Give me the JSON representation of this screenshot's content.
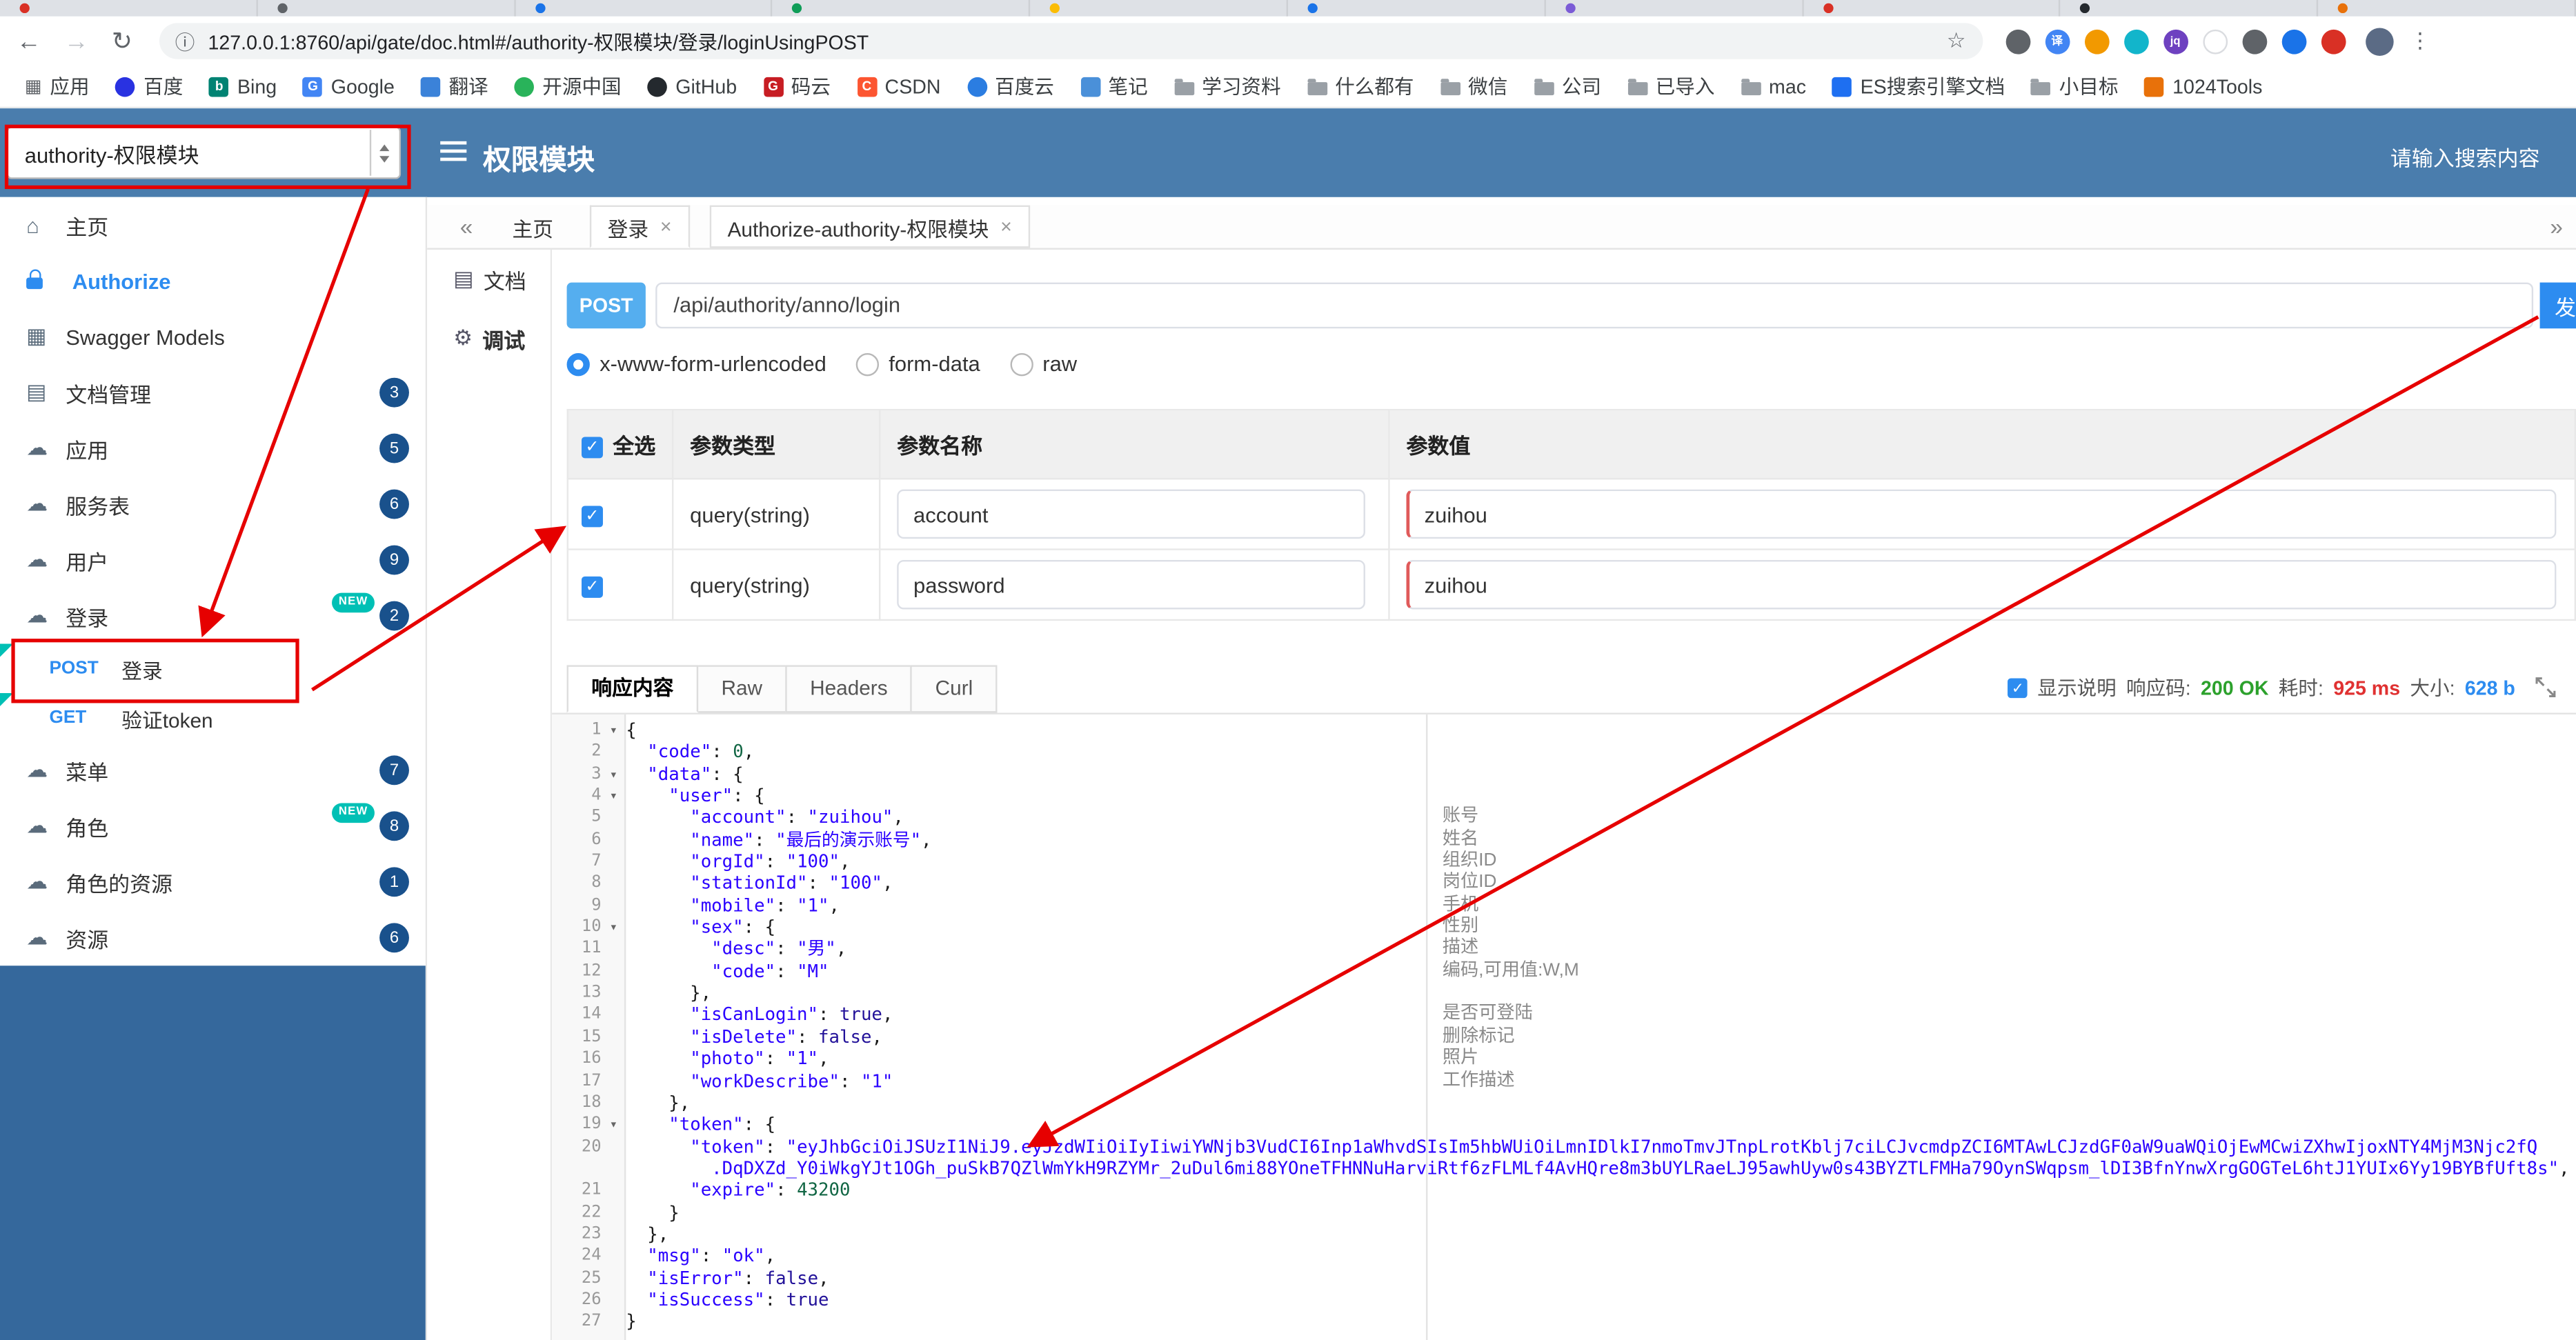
{
  "browser": {
    "tab_favicon_colors": [
      "#d93025",
      "#5f6368",
      "#1a73e8",
      "#0f9d58",
      "#fbbc04",
      "#1a73e8",
      "#7b5bd6",
      "#d93025",
      "#24292e",
      "#e8710a"
    ],
    "url": "127.0.0.1:8760/api/gate/doc.html#/authority-权限模块/登录/loginUsingPOST",
    "extensions": [
      {
        "color": "#5f6368"
      },
      {
        "color": "#4285f4",
        "letter": "译"
      },
      {
        "color": "#f29900"
      },
      {
        "color": "#12b5cb"
      },
      {
        "color": "#6e41c0",
        "letter": "jq"
      },
      {
        "color": "#ffffff"
      },
      {
        "color": "#5f6368"
      },
      {
        "color": "#1a73e8"
      },
      {
        "color": "#d93025"
      }
    ],
    "bookmarks": [
      {
        "label": "应用",
        "icon": "apps"
      },
      {
        "label": "百度",
        "icon": "dot",
        "color": "#2932e1"
      },
      {
        "label": "Bing",
        "icon": "letter",
        "letter": "b",
        "color": "#008373"
      },
      {
        "label": "Google",
        "icon": "letter",
        "letter": "G",
        "color": "#4285f4"
      },
      {
        "label": "翻译",
        "icon": "square",
        "color": "#3b82d9"
      },
      {
        "label": "开源中国",
        "icon": "dot",
        "color": "#29b35a"
      },
      {
        "label": "GitHub",
        "icon": "dot",
        "color": "#24292e"
      },
      {
        "label": "码云",
        "icon": "letter",
        "letter": "G",
        "color": "#c71d23"
      },
      {
        "label": "CSDN",
        "icon": "letter",
        "letter": "C",
        "color": "#fc5531"
      },
      {
        "label": "百度云",
        "icon": "dot",
        "color": "#2b7de1"
      },
      {
        "label": "笔记",
        "icon": "square",
        "color": "#4a90d9"
      },
      {
        "label": "学习资料",
        "icon": "folder"
      },
      {
        "label": "什么都有",
        "icon": "folder"
      },
      {
        "label": "微信",
        "icon": "folder"
      },
      {
        "label": "公司",
        "icon": "folder"
      },
      {
        "label": "已导入",
        "icon": "folder"
      },
      {
        "label": "mac",
        "icon": "folder"
      },
      {
        "label": "ES搜索引擎文档",
        "icon": "square",
        "color": "#1e6ff1"
      },
      {
        "label": "小目标",
        "icon": "folder"
      },
      {
        "label": "1024Tools",
        "icon": "square",
        "color": "#e8710a"
      }
    ]
  },
  "header": {
    "module_select": "authority-权限模块",
    "title": "权限模块",
    "search_placeholder": "请输入搜索内容"
  },
  "sidebar": {
    "items": [
      {
        "key": "home",
        "icon": "home",
        "label": "主页"
      },
      {
        "key": "authorize",
        "icon": "lock",
        "label": "Authorize",
        "accent": true
      },
      {
        "key": "swagger-models",
        "icon": "models",
        "label": "Swagger Models"
      },
      {
        "key": "doc-management",
        "icon": "doc",
        "label": "文档管理",
        "badge": "3"
      },
      {
        "key": "application",
        "icon": "cloud",
        "label": "应用",
        "badge": "5"
      },
      {
        "key": "service-table",
        "icon": "cloud",
        "label": "服务表",
        "badge": "6"
      },
      {
        "key": "user",
        "icon": "cloud",
        "label": "用户",
        "badge": "9"
      },
      {
        "key": "login",
        "icon": "cloud",
        "label": "登录",
        "badge": "2",
        "new": true
      },
      {
        "key": "login-post",
        "type": "api",
        "method": "POST",
        "label": "登录"
      },
      {
        "key": "verify-token-get",
        "type": "api",
        "method": "GET",
        "label": "验证token"
      },
      {
        "key": "menu",
        "icon": "cloud",
        "label": "菜单",
        "badge": "7"
      },
      {
        "key": "role",
        "icon": "cloud",
        "label": "角色",
        "badge": "8",
        "new": true
      },
      {
        "key": "role-resource",
        "icon": "cloud",
        "label": "角色的资源",
        "badge": "1"
      },
      {
        "key": "resource",
        "icon": "cloud",
        "label": "资源",
        "badge": "6"
      }
    ]
  },
  "tabs": {
    "items": [
      {
        "label": "主页",
        "closable": false,
        "active": false
      },
      {
        "label": "登录",
        "closable": true,
        "active": true
      },
      {
        "label": "Authorize-authority-权限模块",
        "closable": true,
        "active": false
      }
    ]
  },
  "doc_tabs": [
    {
      "key": "doc",
      "label": "文档",
      "active": false
    },
    {
      "key": "debug",
      "label": "调试",
      "active": true
    }
  ],
  "request": {
    "method": "POST",
    "url": "/api/authority/anno/login",
    "send_label": "发送",
    "content_types": [
      "x-www-form-urlencoded",
      "form-data",
      "raw"
    ],
    "selected_type": 0
  },
  "params_table": {
    "select_all": "全选",
    "headers": [
      "参数类型",
      "参数名称",
      "参数值"
    ],
    "rows": [
      {
        "type": "query(string)",
        "name": "account",
        "value": "zuihou"
      },
      {
        "type": "query(string)",
        "name": "password",
        "value": "zuihou"
      }
    ]
  },
  "response": {
    "tabs": [
      "响应内容",
      "Raw",
      "Headers",
      "Curl"
    ],
    "active_tab": 0,
    "show_desc_label": "显示说明",
    "meta": [
      {
        "label": "响应码:",
        "value": "200 OK",
        "color": "#2ca12c"
      },
      {
        "label": "耗时:",
        "value": "925 ms",
        "color": "#e03131"
      },
      {
        "label": "大小:",
        "value": "628 b",
        "color": "#2d8cf0"
      }
    ]
  },
  "code": {
    "rows": [
      [
        "1",
        true,
        [
          [
            "p",
            "{"
          ]
        ],
        ""
      ],
      [
        "2",
        false,
        [
          [
            "p",
            "  "
          ],
          [
            "s",
            "\"code\""
          ],
          [
            "p",
            ": "
          ],
          [
            "m",
            "0"
          ],
          [
            "p",
            ","
          ]
        ],
        ""
      ],
      [
        "3",
        true,
        [
          [
            "p",
            "  "
          ],
          [
            "s",
            "\"data\""
          ],
          [
            "p",
            ": {"
          ]
        ],
        ""
      ],
      [
        "4",
        true,
        [
          [
            "p",
            "    "
          ],
          [
            "s",
            "\"user\""
          ],
          [
            "p",
            ": {"
          ]
        ],
        ""
      ],
      [
        "5",
        false,
        [
          [
            "p",
            "      "
          ],
          [
            "s",
            "\"account\""
          ],
          [
            "p",
            ": "
          ],
          [
            "s",
            "\"zuihou\""
          ],
          [
            "p",
            ","
          ]
        ],
        "账号"
      ],
      [
        "6",
        false,
        [
          [
            "p",
            "      "
          ],
          [
            "s",
            "\"name\""
          ],
          [
            "p",
            ": "
          ],
          [
            "s",
            "\"最后的演示账号\""
          ],
          [
            "p",
            ","
          ]
        ],
        "姓名"
      ],
      [
        "7",
        false,
        [
          [
            "p",
            "      "
          ],
          [
            "s",
            "\"orgId\""
          ],
          [
            "p",
            ": "
          ],
          [
            "s",
            "\"100\""
          ],
          [
            "p",
            ","
          ]
        ],
        "组织ID"
      ],
      [
        "8",
        false,
        [
          [
            "p",
            "      "
          ],
          [
            "s",
            "\"stationId\""
          ],
          [
            "p",
            ": "
          ],
          [
            "s",
            "\"100\""
          ],
          [
            "p",
            ","
          ]
        ],
        "岗位ID"
      ],
      [
        "9",
        false,
        [
          [
            "p",
            "      "
          ],
          [
            "s",
            "\"mobile\""
          ],
          [
            "p",
            ": "
          ],
          [
            "s",
            "\"1\""
          ],
          [
            "p",
            ","
          ]
        ],
        "手机"
      ],
      [
        "10",
        true,
        [
          [
            "p",
            "      "
          ],
          [
            "s",
            "\"sex\""
          ],
          [
            "p",
            ": {"
          ]
        ],
        "性别"
      ],
      [
        "11",
        false,
        [
          [
            "p",
            "        "
          ],
          [
            "s",
            "\"desc\""
          ],
          [
            "p",
            ": "
          ],
          [
            "s",
            "\"男\""
          ],
          [
            "p",
            ","
          ]
        ],
        "描述"
      ],
      [
        "12",
        false,
        [
          [
            "p",
            "        "
          ],
          [
            "s",
            "\"code\""
          ],
          [
            "p",
            ": "
          ],
          [
            "s",
            "\"M\""
          ]
        ],
        "编码,可用值:W,M"
      ],
      [
        "13",
        false,
        [
          [
            "p",
            "      },"
          ]
        ],
        ""
      ],
      [
        "14",
        false,
        [
          [
            "p",
            "      "
          ],
          [
            "s",
            "\"isCanLogin\""
          ],
          [
            "p",
            ": "
          ],
          [
            "b",
            "true"
          ],
          [
            "p",
            ","
          ]
        ],
        "是否可登陆"
      ],
      [
        "15",
        false,
        [
          [
            "p",
            "      "
          ],
          [
            "s",
            "\"isDelete\""
          ],
          [
            "p",
            ": "
          ],
          [
            "b",
            "false"
          ],
          [
            "p",
            ","
          ]
        ],
        "删除标记"
      ],
      [
        "16",
        false,
        [
          [
            "p",
            "      "
          ],
          [
            "s",
            "\"photo\""
          ],
          [
            "p",
            ": "
          ],
          [
            "s",
            "\"1\""
          ],
          [
            "p",
            ","
          ]
        ],
        "照片"
      ],
      [
        "17",
        false,
        [
          [
            "p",
            "      "
          ],
          [
            "s",
            "\"workDescribe\""
          ],
          [
            "p",
            ": "
          ],
          [
            "s",
            "\"1\""
          ]
        ],
        "工作描述"
      ],
      [
        "18",
        false,
        [
          [
            "p",
            "    },"
          ]
        ],
        ""
      ],
      [
        "19",
        true,
        [
          [
            "p",
            "    "
          ],
          [
            "s",
            "\"token\""
          ],
          [
            "p",
            ": {"
          ]
        ],
        ""
      ],
      [
        "20",
        false,
        [
          [
            "p",
            "      "
          ],
          [
            "s",
            "\"token\""
          ],
          [
            "p",
            ": "
          ],
          [
            "s",
            "\"eyJhbGciOiJSUzI1NiJ9.eyJzdWIiOiIyIiwiYWNjb3VudCI6Inp1aWhvdSIsIm5hbWUiOiLmnIDlkI7nmoTmvJTnpLrotKblj7ciLCJvcmdpZCI6MTAwLCJzdGF0aW9uaWQiOjEwMCwiZXhwIjoxNTY4MjM3Njc2fQ"
          ]
        ],
        ""
      ],
      [
        "",
        false,
        [
          [
            "s",
            "        .DqDXZd_Y0iWkgYJt1OGh_puSkB7QZlWmYkH9RZYMr_2uDul6mi88YOneTFHNNuHarviRtf6zFLMLf4AvHQre8m3bUYLRaeLJ95awhUyw0s43BYZTLFMHa79OynSWqpsm_lDI3BfnYnwXrgGOGTeL6htJ1YUIx6Yy19BYBfUft8s\""
          ],
          [
            "p",
            ","
          ]
        ],
        ""
      ],
      [
        "21",
        false,
        [
          [
            "p",
            "      "
          ],
          [
            "s",
            "\"expire\""
          ],
          [
            "p",
            ": "
          ],
          [
            "m",
            "43200"
          ]
        ],
        ""
      ],
      [
        "22",
        false,
        [
          [
            "p",
            "    }"
          ]
        ],
        ""
      ],
      [
        "23",
        false,
        [
          [
            "p",
            "  },"
          ]
        ],
        ""
      ],
      [
        "24",
        false,
        [
          [
            "p",
            "  "
          ],
          [
            "s",
            "\"msg\""
          ],
          [
            "p",
            ": "
          ],
          [
            "s",
            "\"ok\""
          ],
          [
            "p",
            ","
          ]
        ],
        ""
      ],
      [
        "25",
        false,
        [
          [
            "p",
            "  "
          ],
          [
            "s",
            "\"isError\""
          ],
          [
            "p",
            ": "
          ],
          [
            "b",
            "false"
          ],
          [
            "p",
            ","
          ]
        ],
        ""
      ],
      [
        "26",
        false,
        [
          [
            "p",
            "  "
          ],
          [
            "s",
            "\"isSuccess\""
          ],
          [
            "p",
            ": "
          ],
          [
            "b",
            "true"
          ]
        ],
        ""
      ],
      [
        "27",
        false,
        [
          [
            "p",
            "}"
          ]
        ],
        ""
      ]
    ]
  },
  "colors": {
    "accent": "#2d8cf0",
    "header_blue": "#4a7dad",
    "sidebar_blue": "#35689c",
    "badge_navy": "#19518c",
    "new_teal": "#00c0b5",
    "annotation_red": "#e60000",
    "code_string_blue": "#2a00ff"
  }
}
